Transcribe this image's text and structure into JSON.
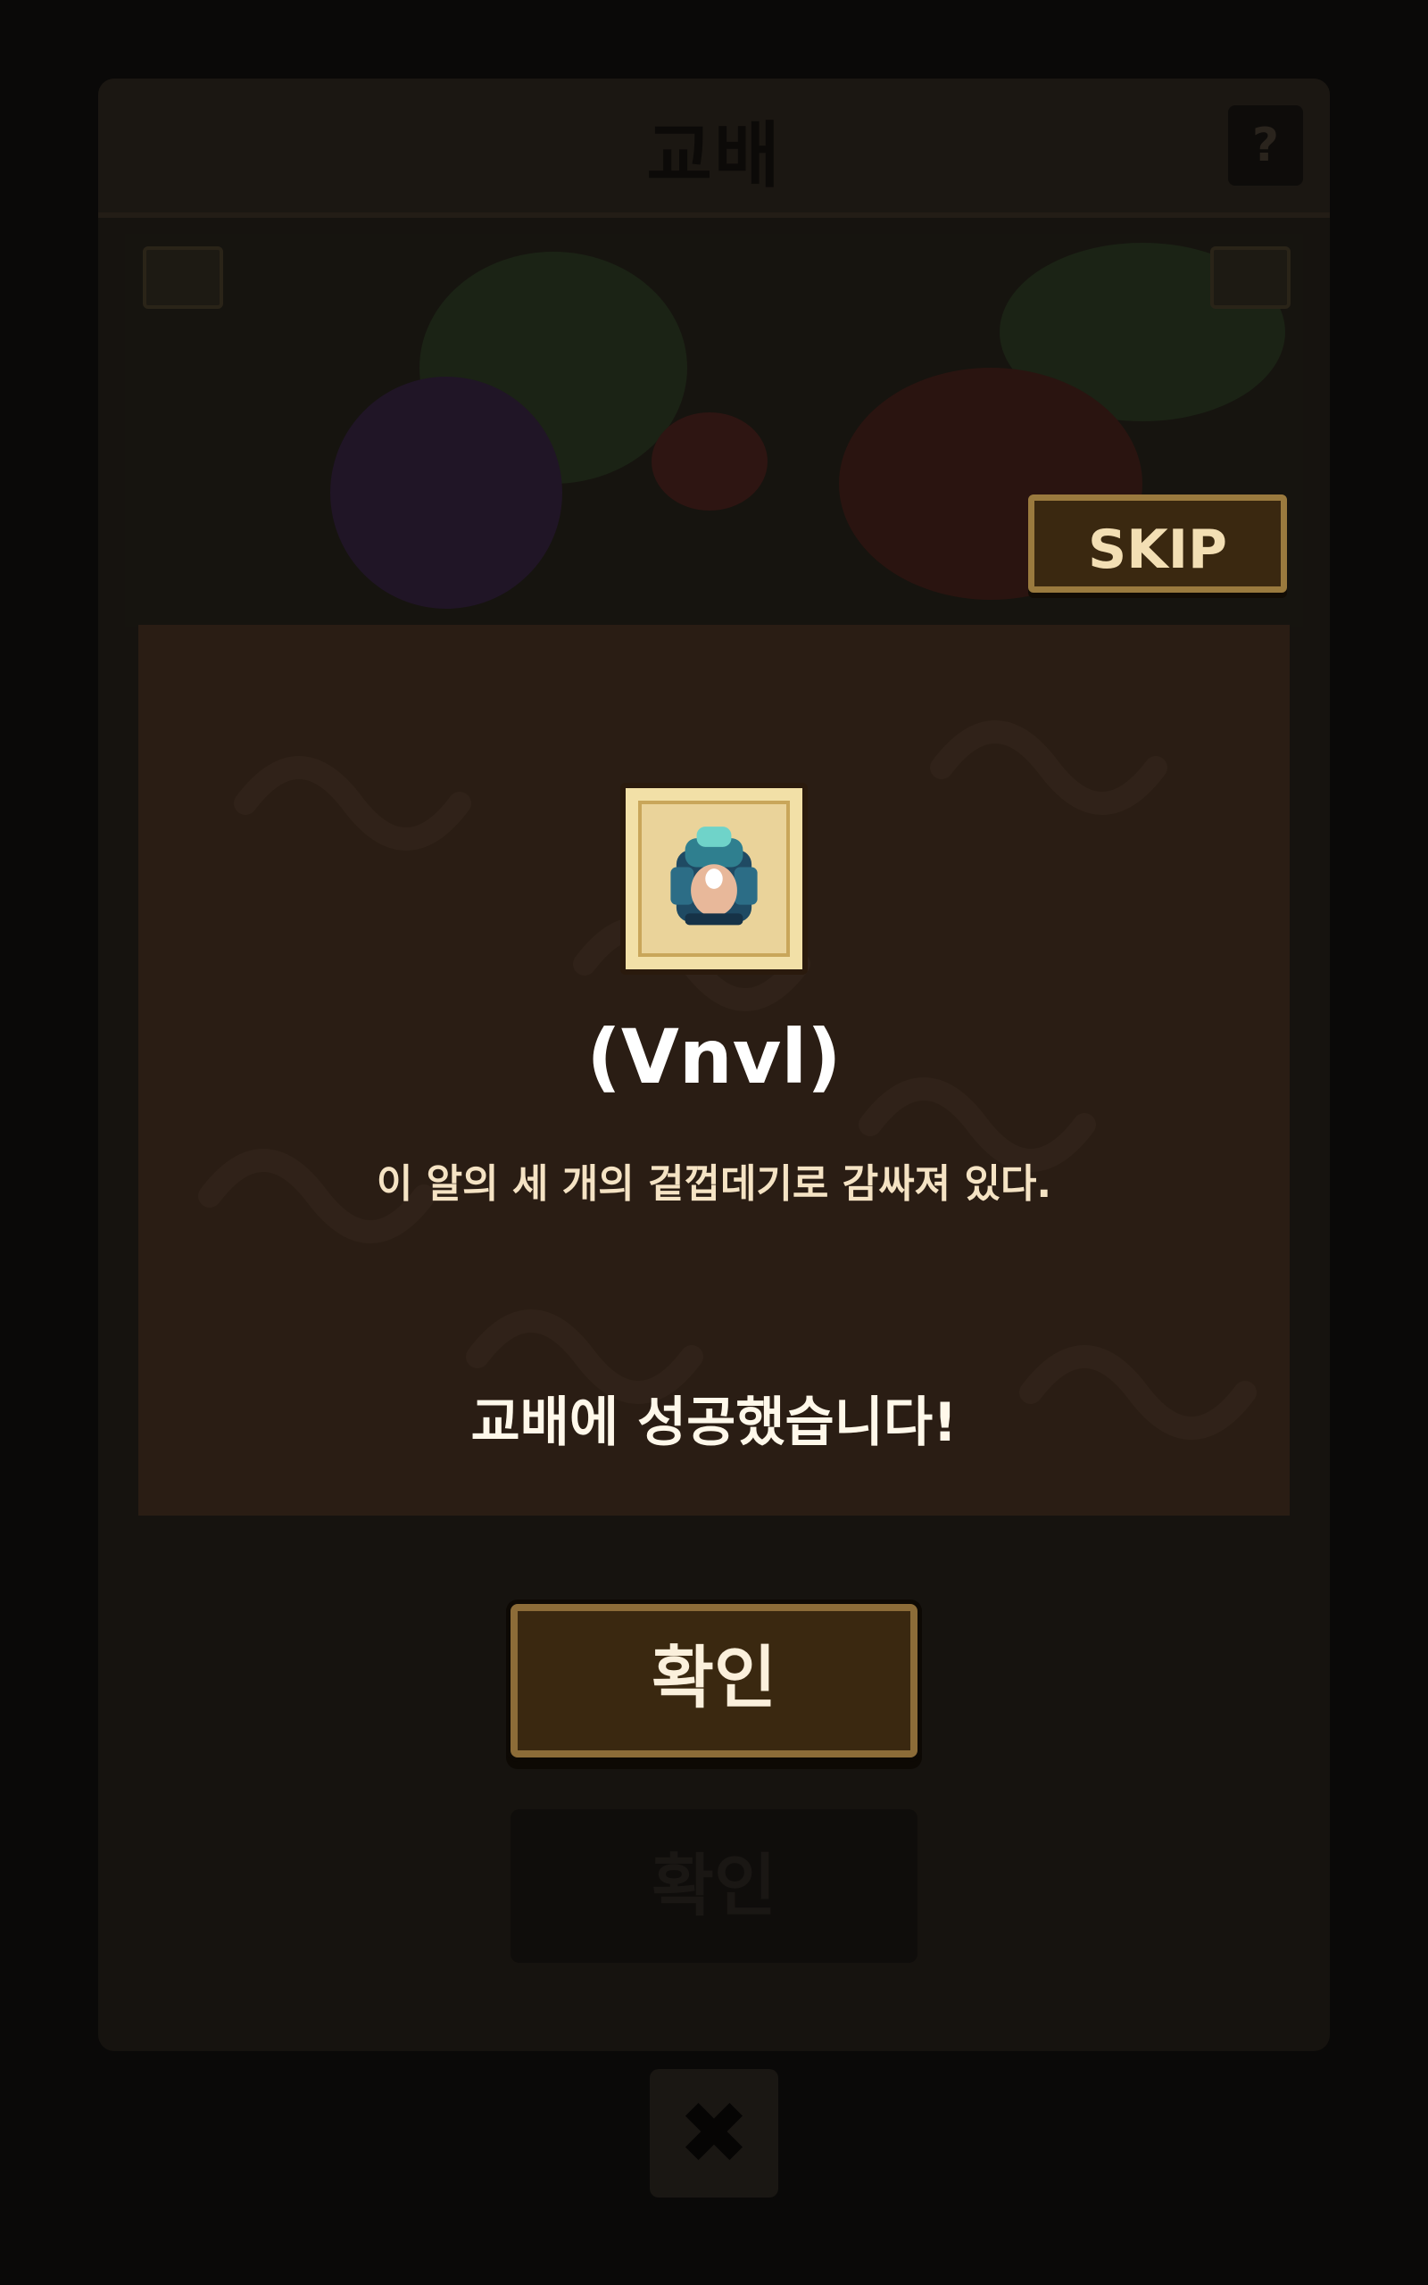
{
  "dialog": {
    "title": "교배",
    "help_label": "?"
  },
  "scene": {
    "skip_label": "SKIP"
  },
  "result": {
    "item_icon": "dragon-egg-icon",
    "item_name": "(Vnvl)",
    "item_description": "이 알의 세 개의 겉껍데기로 감싸져 있다.",
    "message": "교배에 성공했습니다!"
  },
  "buttons": {
    "confirm_label": "확인",
    "confirm_disabled_label": "확인",
    "close_label": "✖"
  },
  "colors": {
    "overlay_bg": "#2a1d14",
    "button_border": "#8c6c38",
    "item_frame": "#f2e0a7"
  }
}
